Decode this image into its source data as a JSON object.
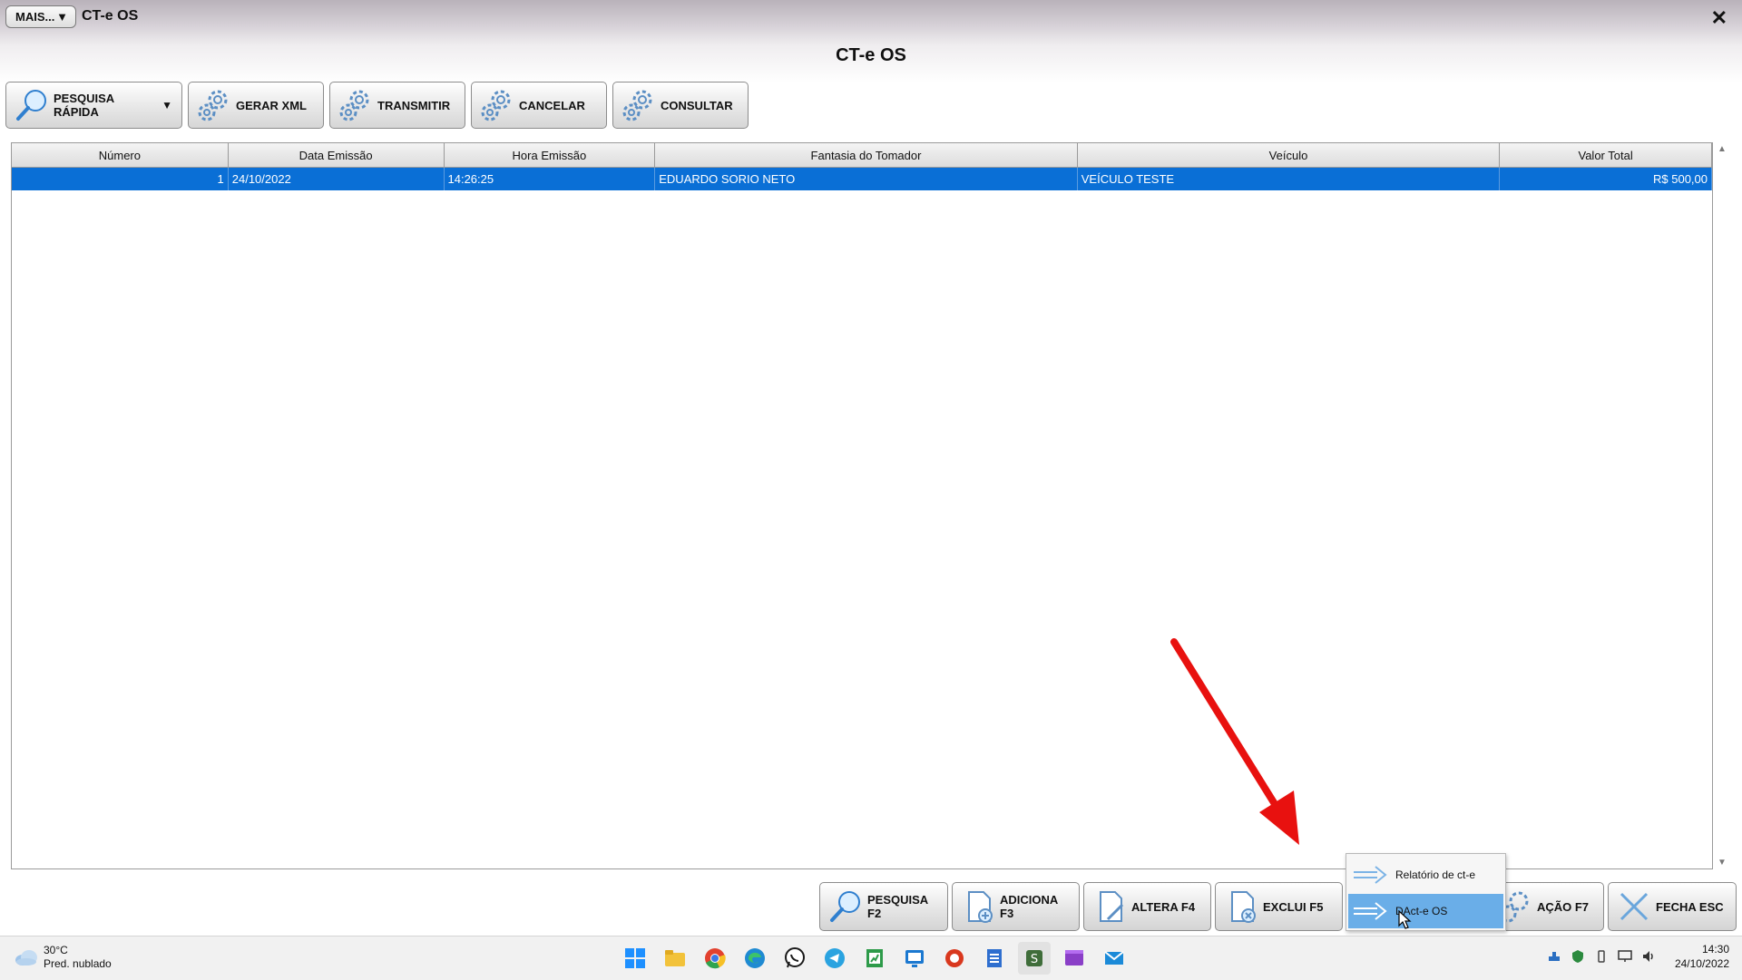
{
  "window": {
    "more_label": "MAIS...",
    "more_caret": "▼",
    "app_title": "CT-e OS",
    "close_glyph": "✕"
  },
  "page": {
    "title": "CT-e OS"
  },
  "toolbar": {
    "quick_search": "PESQUISA RÁPIDA",
    "quick_search_caret": "▼",
    "generate_xml": "GERAR XML",
    "transmit": "TRANSMITIR",
    "cancel": "CANCELAR",
    "query": "CONSULTAR"
  },
  "grid": {
    "columns": [
      "Número",
      "Data Emissão",
      "Hora Emissão",
      "Fantasia do Tomador",
      "Veículo",
      "Valor Total"
    ],
    "rows": [
      {
        "numero": "1",
        "data": "24/10/2022",
        "hora": "14:26:25",
        "tomador": "EDUARDO SORIO NETO",
        "veiculo": "VEÍCULO TESTE",
        "valor": "R$ 500,00"
      }
    ]
  },
  "scrollbar": {
    "up": "▲",
    "down": "▼"
  },
  "bottom": {
    "search": "PESQUISA F2",
    "add": "ADICIONA F3",
    "edit": "ALTERA F4",
    "delete": "EXCLUI F5",
    "action": "AÇÃO F7",
    "close": "FECHA ESC"
  },
  "popup_menu": {
    "items": [
      "Relatório de ct-e",
      "DAct-e OS"
    ],
    "selected_index": 1
  },
  "taskbar": {
    "weather_temp": "30°C",
    "weather_desc": "Pred. nublado",
    "time": "14:30",
    "date": "24/10/2022",
    "icons": [
      "windows-start-icon",
      "file-explorer-icon",
      "chrome-icon",
      "edge-icon",
      "whatsapp-icon",
      "telegram-icon",
      "spreadsheet-icon",
      "remote-desktop-icon",
      "app-icon",
      "notepad-icon",
      "active-app-icon",
      "video-editor-icon",
      "mail-icon"
    ]
  },
  "colors": {
    "selection": "#0a6fd6",
    "menu_highlight": "#6aaee8",
    "arrow": "#e8110f"
  }
}
